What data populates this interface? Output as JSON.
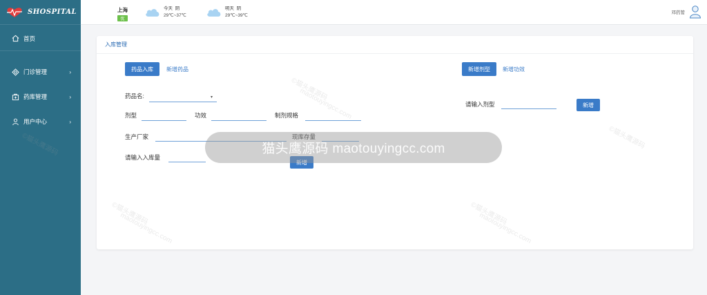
{
  "brand": {
    "logo_text": "SHOSPITAL"
  },
  "sidebar": {
    "home": {
      "label": "首页",
      "icon": "home-icon"
    },
    "items": [
      {
        "label": "门诊管理",
        "icon": "clinic-icon"
      },
      {
        "label": "药库管理",
        "icon": "pharmacy-icon"
      },
      {
        "label": "用户中心",
        "icon": "user-icon"
      }
    ]
  },
  "header": {
    "city": "上海",
    "aqi": "优",
    "today": {
      "label": "今天",
      "condition": "阴",
      "temp": "29℃~37℃"
    },
    "tomorrow": {
      "label": "明天",
      "condition": "阴",
      "temp": "29℃~39℃"
    },
    "username": "邓药管"
  },
  "card": {
    "title": "入库管理",
    "left_tabs": {
      "active": "药品入库",
      "other": "新增药品"
    },
    "right_tabs": {
      "active": "新增剂型",
      "other": "新增功效"
    },
    "form": {
      "drug_name_label": "药品名:",
      "dosage_label": "剂型",
      "efficacy_label": "功效",
      "spec_label": "制剂规格",
      "maker_label": "生产厂家",
      "stock_label": "现库存量",
      "qty_label": "请输入入库量",
      "add_label": "新增"
    },
    "right_form": {
      "dosage_label": "请输入剂型",
      "add_label": "新增"
    }
  },
  "watermark": {
    "pill_text": "猫头鹰源码 maotouyingcc.com",
    "tile_a": "©猫头鹰源码",
    "tile_b": "maotouyingcc.com"
  },
  "colors": {
    "sidebar": "#2c6e86",
    "accent": "#3a7bc8",
    "aqi": "#6cc04a"
  }
}
